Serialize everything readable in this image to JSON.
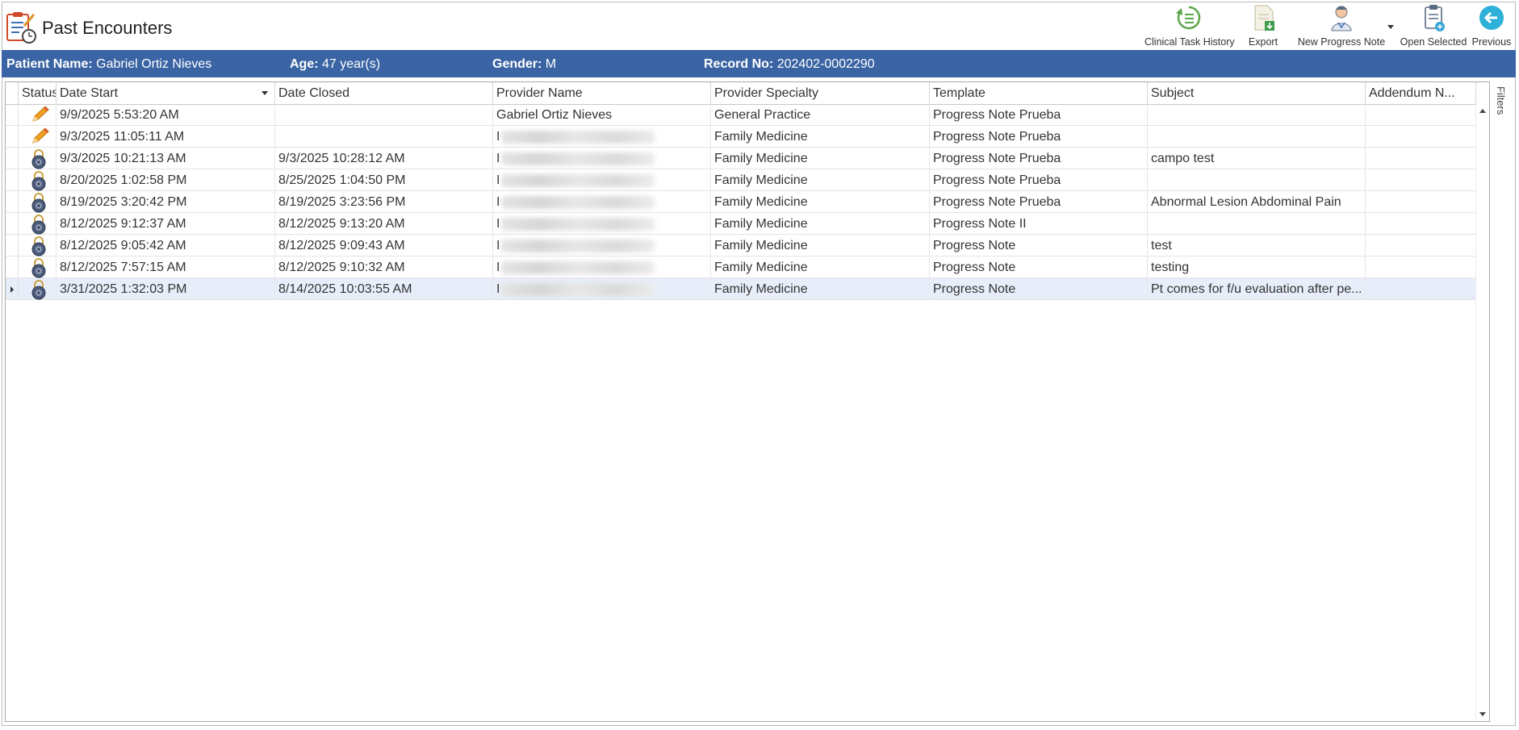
{
  "header": {
    "title": "Past Encounters"
  },
  "toolbar": {
    "clinical_task_history": "Clinical Task History",
    "export": "Export",
    "new_progress_note": "New Progress Note",
    "open_selected": "Open Selected",
    "previous": "Previous"
  },
  "patient": {
    "name_label": "Patient Name:",
    "name_value": "Gabriel Ortiz Nieves",
    "age_label": "Age:",
    "age_value": "47 year(s)",
    "gender_label": "Gender:",
    "gender_value": "M",
    "record_label": "Record No:",
    "record_value": "202402-0002290"
  },
  "table": {
    "columns": [
      "Status",
      "Date Start",
      "Date Closed",
      "Provider Name",
      "Provider Specialty",
      "Template",
      "Subject",
      "Addendum N..."
    ],
    "rows": [
      {
        "status": "pencil-icon",
        "date_start": "9/9/2025 5:53:20 AM",
        "date_closed": "",
        "provider": "Gabriel Ortiz Nieves",
        "specialty": "General Practice",
        "template": "Progress Note Prueba",
        "subject": "",
        "addendum": ""
      },
      {
        "status": "pencil-icon",
        "date_start": "9/3/2025 11:05:11 AM",
        "date_closed": "",
        "provider": "I",
        "specialty": "Family Medicine",
        "template": "Progress Note Prueba",
        "subject": "",
        "addendum": ""
      },
      {
        "status": "lock-icon",
        "date_start": "9/3/2025 10:21:13 AM",
        "date_closed": "9/3/2025 10:28:12 AM",
        "provider": "I",
        "specialty": "Family Medicine",
        "template": "Progress Note Prueba",
        "subject": "campo test",
        "addendum": ""
      },
      {
        "status": "lock-icon",
        "date_start": "8/20/2025 1:02:58 PM",
        "date_closed": "8/25/2025 1:04:50 PM",
        "provider": "I",
        "specialty": "Family Medicine",
        "template": "Progress Note Prueba",
        "subject": "",
        "addendum": ""
      },
      {
        "status": "lock-icon",
        "date_start": "8/19/2025 3:20:42 PM",
        "date_closed": "8/19/2025 3:23:56 PM",
        "provider": "I",
        "specialty": "Family Medicine",
        "template": "Progress Note Prueba",
        "subject": "Abnormal Lesion  Abdominal Pain",
        "addendum": ""
      },
      {
        "status": "lock-icon",
        "date_start": "8/12/2025 9:12:37 AM",
        "date_closed": "8/12/2025 9:13:20 AM",
        "provider": "I",
        "specialty": "Family Medicine",
        "template": "Progress Note II",
        "subject": "",
        "addendum": ""
      },
      {
        "status": "lock-icon",
        "date_start": "8/12/2025 9:05:42 AM",
        "date_closed": "8/12/2025 9:09:43 AM",
        "provider": "I",
        "specialty": "Family Medicine",
        "template": "Progress Note",
        "subject": "test",
        "addendum": ""
      },
      {
        "status": "lock-icon",
        "date_start": "8/12/2025 7:57:15 AM",
        "date_closed": "8/12/2025 9:10:32 AM",
        "provider": "I",
        "specialty": "Family Medicine",
        "template": "Progress Note",
        "subject": "testing",
        "addendum": ""
      },
      {
        "status": "lock-icon",
        "date_start": "3/31/2025 1:32:03 PM",
        "date_closed": "8/14/2025 10:03:55 AM",
        "provider": "I",
        "specialty": "Family Medicine",
        "template": "Progress Note",
        "subject": "Pt comes for f/u evaluation after pe...",
        "addendum": "",
        "selected": true
      }
    ]
  },
  "filters": {
    "label": "Filters"
  },
  "colors": {
    "patient_bar": "#3a64a4",
    "selected_row": "#e8eef9",
    "pencil": "#f0a020",
    "lock": "#4a5a78"
  }
}
